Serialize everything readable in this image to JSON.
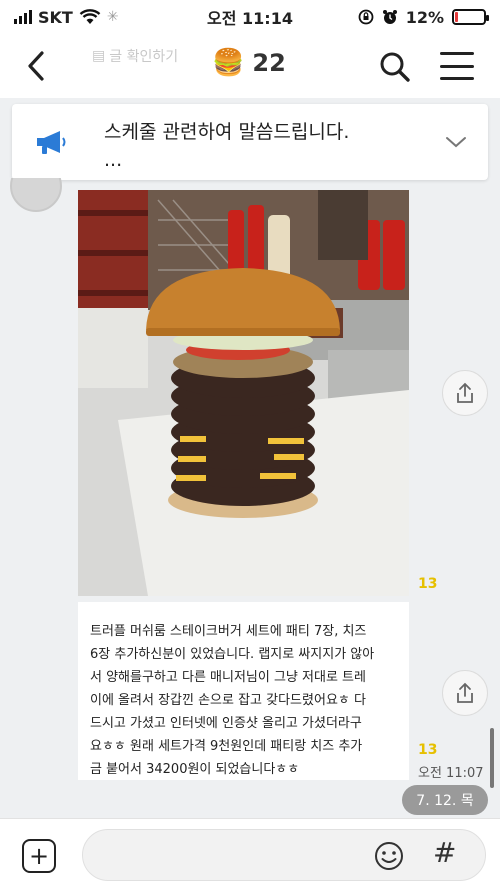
{
  "status_bar": {
    "carrier": "SKT",
    "time": "오전 11:14",
    "battery": "12%",
    "battery_level": 0.12
  },
  "header": {
    "ghost_text": "글 확인하기",
    "title_emoji": "🍔",
    "member_count": "22"
  },
  "notice": {
    "line1": "스케줄 관련하여 말씀드립니다.",
    "line2": "..."
  },
  "messages": [
    {
      "type": "image",
      "unread": "13",
      "icon": "share-icon"
    },
    {
      "type": "text",
      "unread": "13",
      "time": "오전 11:07",
      "lines": [
        "트러플 머쉬룸 스테이크버거 세트에 패티 7장, 치즈",
        "6장 추가하신분이 있었습니다. 랩지로 싸지지가 않아",
        "서 양해를구하고 다른 매니저님이 그냥 저대로 트레",
        "이에 올려서 장갑낀 손으로 잡고 갖다드렸어요ㅎ 다",
        "드시고 가셨고 인터넷에 인증샷 올리고 가셨더라구",
        "요ㅎㅎ 원래 세트가격 9천원인데 패티랑 치즈 추가",
        "금 붙어서 34200원이 되었습니다ㅎㅎ"
      ]
    }
  ],
  "date_chip": "7. 12. 목",
  "input_bar": {
    "value": ""
  },
  "colors": {
    "background": "#eef0f2",
    "unread": "#e6c000",
    "notice_icon": "#2b7bd6"
  }
}
